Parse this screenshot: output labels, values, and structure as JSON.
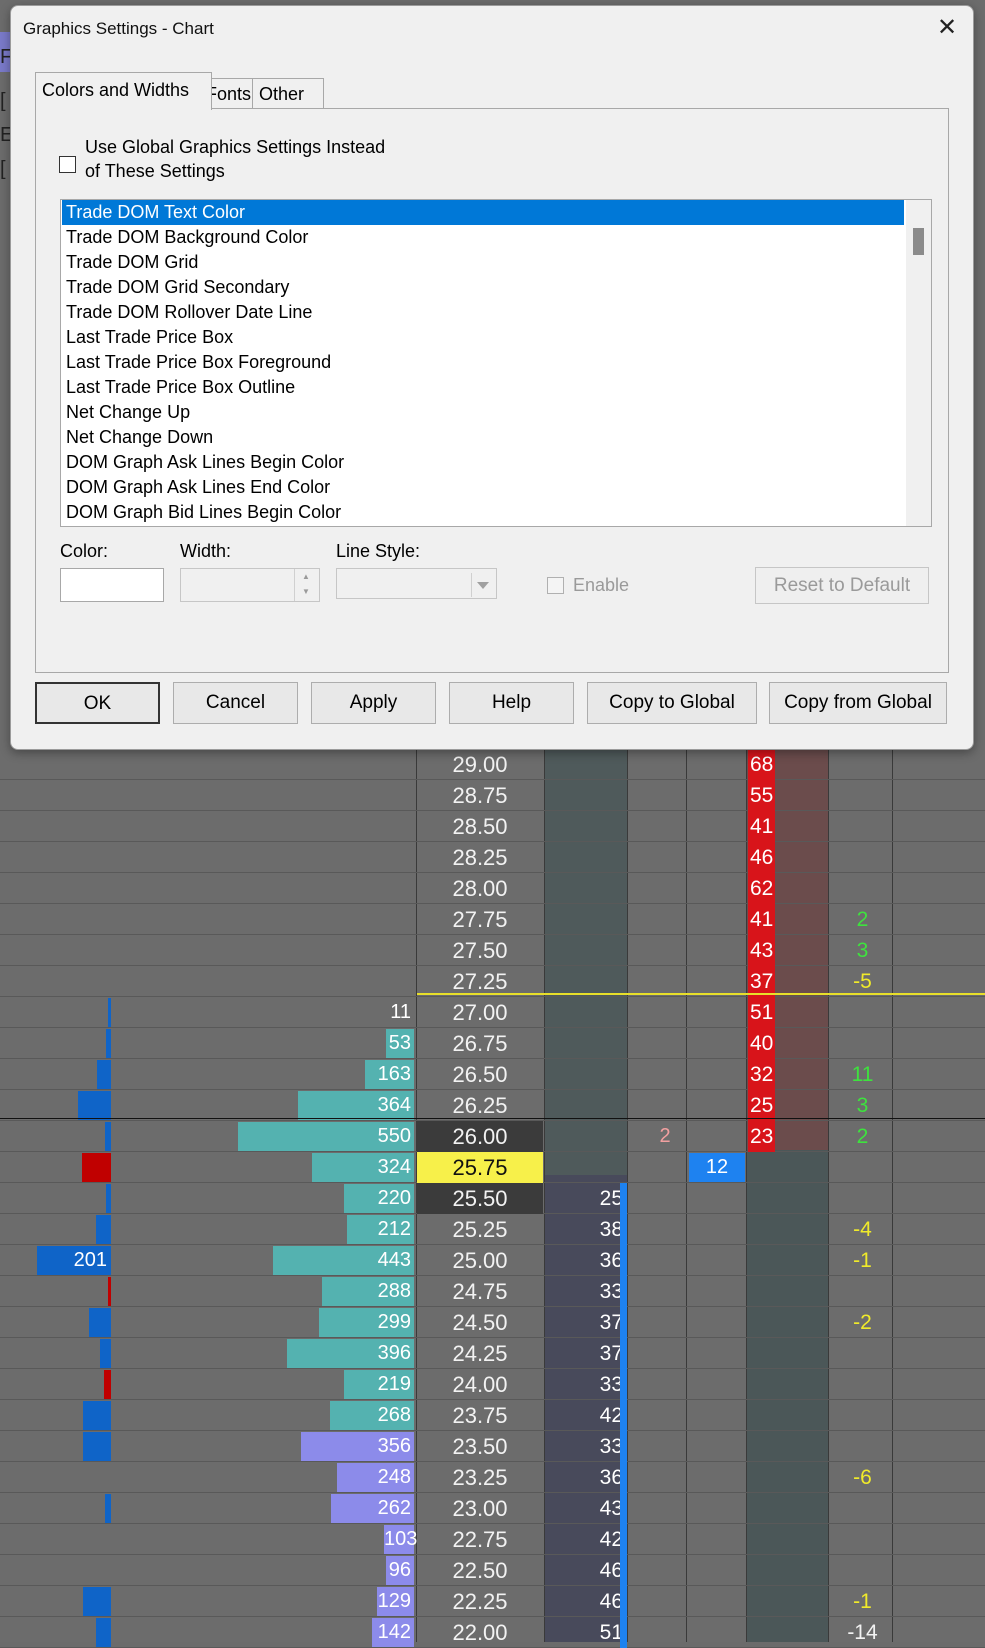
{
  "dialog": {
    "title": "Graphics Settings  - Chart",
    "close_glyph": "✕",
    "tabs": [
      "Colors and Widths",
      "Fonts",
      "Other"
    ],
    "use_global_label_line1": "Use Global Graphics Settings Instead",
    "use_global_label_line2": "of These Settings",
    "list_items": [
      "Trade DOM Text Color",
      "Trade DOM Background Color",
      "Trade DOM Grid",
      "Trade DOM Grid Secondary",
      "Trade DOM Rollover Date Line",
      "Last Trade Price Box",
      "Last Trade Price Box Foreground",
      "Last Trade Price Box Outline",
      "Net Change Up",
      "Net Change Down",
      "DOM Graph Ask Lines Begin Color",
      "DOM Graph Ask Lines End Color",
      "DOM Graph Bid Lines Begin Color"
    ],
    "selected_index": 0,
    "color_label": "Color:",
    "width_label": "Width:",
    "line_style_label": "Line Style:",
    "enable_label": "Enable",
    "reset_label": "Reset to Default",
    "buttons": {
      "ok": "OK",
      "cancel": "Cancel",
      "apply": "Apply",
      "help": "Help",
      "copy_to_global": "Copy to Global",
      "copy_from_global": "Copy from Global"
    }
  },
  "left_glyphs": [
    "F",
    "[",
    "E",
    "["
  ],
  "ladder": {
    "colors": {
      "ask": "#d8141a",
      "current_price_bg": "#f7f04a",
      "net_up": "#3ee23e",
      "net_down": "#f0ea2a",
      "volume_teal": "#54b2b0",
      "volume_purple": "#8c8bea",
      "delta_blue": "#0f64c8",
      "delta_red": "#c00000"
    },
    "rows": [
      {
        "price": "29.00",
        "ask": "68"
      },
      {
        "price": "28.75",
        "ask": "55"
      },
      {
        "price": "28.50",
        "ask": "41"
      },
      {
        "price": "28.25",
        "ask": "46"
      },
      {
        "price": "28.00",
        "ask": "62"
      },
      {
        "price": "27.75",
        "ask": "41",
        "net": "2",
        "net_color": "g"
      },
      {
        "price": "27.50",
        "ask": "43",
        "net": "3",
        "net_color": "g"
      },
      {
        "price": "27.25",
        "ask": "37",
        "net": "-5",
        "net_color": "y"
      },
      {
        "price": "27.00",
        "ask": "51",
        "vol": "11",
        "vol_pct": 0.0,
        "delta": "blue",
        "delta_w": 3
      },
      {
        "price": "26.75",
        "ask": "40",
        "vol": "53",
        "vol_pct": 0.03,
        "delta": "blue",
        "delta_w": 5
      },
      {
        "price": "26.50",
        "ask": "32",
        "vol": "163",
        "vol_pct": 0.28,
        "delta": "blue",
        "delta_w": 14,
        "net": "11",
        "net_color": "g"
      },
      {
        "price": "26.25",
        "ask": "25",
        "vol": "364",
        "vol_pct": 0.66,
        "delta": "blue",
        "delta_w": 33,
        "net": "3",
        "net_color": "g"
      },
      {
        "price": "26.00",
        "ask": "23",
        "vol": "550",
        "vol_pct": 1.0,
        "delta": "blue",
        "delta_w": 6,
        "net": "2",
        "net_color": "g",
        "price_dark": true,
        "small": "2"
      },
      {
        "price": "25.75",
        "vol": "324",
        "vol_pct": 0.58,
        "delta": "red",
        "delta_w": 29,
        "current": true,
        "blue_box": "12"
      },
      {
        "price": "25.50",
        "bid": "25",
        "vol": "220",
        "vol_pct": 0.4,
        "delta": "blue",
        "delta_w": 5,
        "price_dark": true
      },
      {
        "price": "25.25",
        "bid": "38",
        "vol": "212",
        "vol_pct": 0.38,
        "delta": "blue",
        "delta_w": 15,
        "net": "-4",
        "net_color": "y"
      },
      {
        "price": "25.00",
        "bid": "36",
        "vol": "443",
        "vol_pct": 0.8,
        "delta": "blue",
        "delta_w": 74,
        "delta_text": "201",
        "net": "-1",
        "net_color": "y"
      },
      {
        "price": "24.75",
        "bid": "33",
        "vol": "288",
        "vol_pct": 0.52,
        "delta": "red",
        "delta_w": 3
      },
      {
        "price": "24.50",
        "bid": "37",
        "vol": "299",
        "vol_pct": 0.54,
        "delta": "blue",
        "delta_w": 22,
        "net": "-2",
        "net_color": "y"
      },
      {
        "price": "24.25",
        "bid": "37",
        "vol": "396",
        "vol_pct": 0.72,
        "delta": "blue",
        "delta_w": 11
      },
      {
        "price": "24.00",
        "bid": "33",
        "vol": "219",
        "vol_pct": 0.4,
        "delta": "red",
        "delta_w": 7
      },
      {
        "price": "23.75",
        "bid": "42",
        "vol": "268",
        "vol_pct": 0.48,
        "delta": "blue",
        "delta_w": 28
      },
      {
        "price": "23.50",
        "bid": "33",
        "vol": "356",
        "vol_pct": 0.64,
        "vol_purple": true,
        "delta": "blue",
        "delta_w": 28
      },
      {
        "price": "23.25",
        "bid": "36",
        "vol": "248",
        "vol_pct": 0.44,
        "vol_purple": true,
        "net": "-6",
        "net_color": "y"
      },
      {
        "price": "23.00",
        "bid": "43",
        "vol": "262",
        "vol_pct": 0.47,
        "vol_purple": true,
        "delta": "blue",
        "delta_w": 6
      },
      {
        "price": "22.75",
        "bid": "42",
        "vol": "103",
        "vol_pct": 0.17,
        "vol_purple": true
      },
      {
        "price": "22.50",
        "bid": "46",
        "vol": "96",
        "vol_pct": 0.15,
        "vol_purple": true
      },
      {
        "price": "22.25",
        "bid": "46",
        "vol": "129",
        "vol_pct": 0.21,
        "vol_purple": true,
        "delta": "blue",
        "delta_w": 28,
        "net": "-1",
        "net_color": "y"
      },
      {
        "price": "22.00",
        "bid": "51",
        "vol": "142",
        "vol_pct": 0.24,
        "vol_purple": true,
        "delta": "blue",
        "delta_w": 15,
        "net": "-14",
        "net_color": "w"
      }
    ]
  }
}
